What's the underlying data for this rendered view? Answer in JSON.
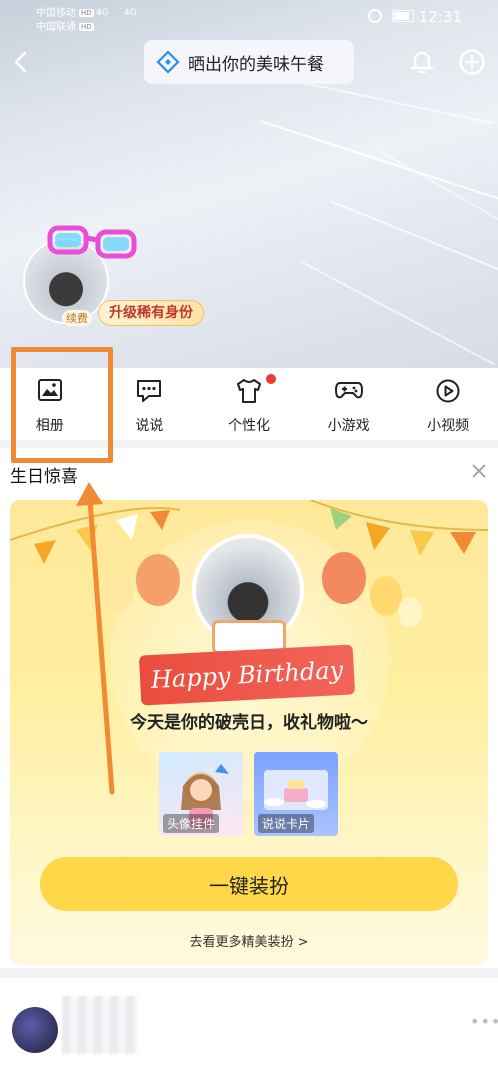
{
  "status_bar": {
    "carrier1": "中国移动",
    "carrier2": "中国联通",
    "hd": "HD",
    "signal": "4G",
    "time": "12:31"
  },
  "header": {
    "search_text": "晒出你的美味午餐"
  },
  "profile": {
    "upgrade_label": "升级稀有身份",
    "renew_label": "续费"
  },
  "nav": {
    "items": [
      {
        "label": "相册"
      },
      {
        "label": "说说"
      },
      {
        "label": "个性化"
      },
      {
        "label": "小游戏"
      },
      {
        "label": "小视频"
      }
    ]
  },
  "birthday": {
    "title": "生日惊喜",
    "ribbon": "Happy Birthday",
    "headline": "今天是你的破壳日，收礼物啦～",
    "gifts": [
      {
        "label": "头像挂件"
      },
      {
        "label": "说说卡片"
      }
    ],
    "primary_button": "一键装扮",
    "more_link": "去看更多精美装扮 >"
  },
  "colors": {
    "highlight": "#f08a35",
    "red_dot": "#ee3a33",
    "button_yellow": "#ffd84a"
  }
}
